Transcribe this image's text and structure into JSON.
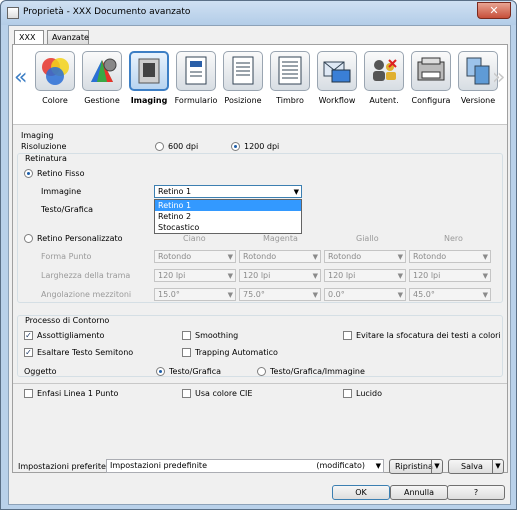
{
  "window": {
    "title": "Proprietà - XXX Documento avanzato",
    "close": "✕"
  },
  "tabs": [
    {
      "label": "XXX"
    },
    {
      "label": "Avanzate"
    }
  ],
  "toolbar": {
    "prev": "«",
    "next": "»",
    "items": [
      {
        "label": "Colore",
        "icon": "color-circles-icon"
      },
      {
        "label": "Gestione",
        "icon": "color-management-icon"
      },
      {
        "label": "Imaging",
        "icon": "imaging-icon",
        "selected": true
      },
      {
        "label": "Formulario",
        "icon": "form-icon"
      },
      {
        "label": "Posizione",
        "icon": "position-icon"
      },
      {
        "label": "Timbro",
        "icon": "stamp-icon"
      },
      {
        "label": "Workflow",
        "icon": "workflow-icon"
      },
      {
        "label": "Autent.",
        "icon": "authentication-icon"
      },
      {
        "label": "Configura",
        "icon": "configure-icon"
      },
      {
        "label": "Versione",
        "icon": "version-icon"
      }
    ]
  },
  "imaging": {
    "section": "Imaging",
    "resolution_label": "Risoluzione",
    "res_600": "600 dpi",
    "res_1200": "1200 dpi",
    "selected_resolution": "1200 dpi"
  },
  "retinatura": {
    "section": "Retinatura",
    "fixed_label": "Retino Fisso",
    "immagine_label": "Immagine",
    "immagine_value": "Retino 1",
    "testo_label": "Testo/Grafica",
    "dropdown_options": [
      "Retino 1",
      "Retino 2",
      "Stocastico"
    ],
    "dropdown_selected": "Retino 1",
    "custom_label": "Retino Personalizzato",
    "columns": [
      "Ciano",
      "Magenta",
      "Giallo",
      "Nero"
    ],
    "rows": [
      {
        "label": "Forma Punto",
        "values": [
          "Rotondo",
          "Rotondo",
          "Rotondo",
          "Rotondo"
        ]
      },
      {
        "label": "Larghezza della trama",
        "values": [
          "120 lpi",
          "120 lpi",
          "120 lpi",
          "120 lpi"
        ]
      },
      {
        "label": "Angolazione mezzitoni",
        "values": [
          "15.0°",
          "75.0°",
          "0.0°",
          "45.0°"
        ]
      }
    ]
  },
  "contour": {
    "section": "Processo di Contorno",
    "thinning": "Assottigliamento",
    "smoothing": "Smoothing",
    "avoid_blur": "Evitare la sfocatura dei testi a colori",
    "emphasize_halftone": "Esaltare Testo Semitono",
    "auto_trapping": "Trapping Automatico",
    "object_label": "Oggetto",
    "obj_text_graphics": "Testo/Grafica",
    "obj_text_graphics_image": "Testo/Grafica/Immagine",
    "selected_object": "Testo/Grafica"
  },
  "extra": {
    "emphasize_line": "Enfasi Linea 1 Punto",
    "cie_color": "Usa colore CIE",
    "glossy": "Lucido"
  },
  "footer": {
    "preferred_label": "Impostazioni preferite",
    "preferred_value": "Impostazioni predefinite",
    "modified": "(modificato)",
    "restore": "Ripristina",
    "save": "Salva",
    "ok": "OK",
    "cancel": "Annulla",
    "help": "?"
  },
  "check_mark": "✓",
  "dropdown_arrow": "▼",
  "colors": {
    "selection": "#3399ff",
    "accent": "#3d7fc5",
    "close": "#c74f3a"
  }
}
